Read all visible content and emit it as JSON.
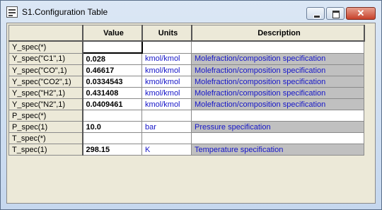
{
  "window": {
    "title": "S1.Configuration Table"
  },
  "titlebar_buttons": {
    "min": "minimize",
    "max": "maximize",
    "close": "✕"
  },
  "table": {
    "headers": {
      "value": "Value",
      "units": "Units",
      "description": "Description"
    },
    "rows": [
      {
        "name": "Y_spec(*)",
        "value": "",
        "units": "",
        "description": ""
      },
      {
        "name": "Y_spec(\"C1\",1)",
        "value": "0.028",
        "units": "kmol/kmol",
        "description": "Molefraction/composition specification"
      },
      {
        "name": "Y_spec(\"CO\",1)",
        "value": "0.46617",
        "units": "kmol/kmol",
        "description": "Molefraction/composition specification"
      },
      {
        "name": "Y_spec(\"CO2\",1)",
        "value": "0.0334543",
        "units": "kmol/kmol",
        "description": "Molefraction/composition specification"
      },
      {
        "name": "Y_spec(\"H2\",1)",
        "value": "0.431408",
        "units": "kmol/kmol",
        "description": "Molefraction/composition specification"
      },
      {
        "name": "Y_spec(\"N2\",1)",
        "value": "0.0409461",
        "units": "kmol/kmol",
        "description": "Molefraction/composition specification"
      },
      {
        "name": "P_spec(*)",
        "value": "",
        "units": "",
        "description": ""
      },
      {
        "name": "P_spec(1)",
        "value": "10.0",
        "units": "bar",
        "description": "Pressure specification"
      },
      {
        "name": "T_spec(*)",
        "value": "",
        "units": "",
        "description": ""
      },
      {
        "name": "T_spec(1)",
        "value": "298.15",
        "units": "K",
        "description": "Temperature specification"
      }
    ]
  }
}
